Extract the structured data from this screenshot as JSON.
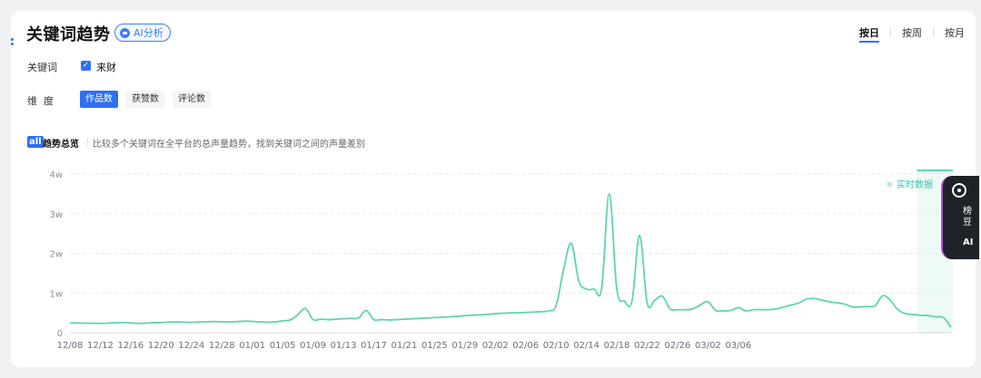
{
  "header": {
    "title": "关键词趋势",
    "ai_badge": "AI分析",
    "tabs": [
      {
        "label": "按日",
        "active": true
      },
      {
        "label": "按周",
        "active": false
      },
      {
        "label": "按月",
        "active": false
      }
    ]
  },
  "filters": {
    "keyword_label": "关键词",
    "keyword": "来财",
    "dimension_label": "维  度",
    "dimensions": [
      {
        "label": "作品数",
        "active": true
      },
      {
        "label": "获赞数",
        "active": false
      },
      {
        "label": "评论数",
        "active": false
      }
    ]
  },
  "section": {
    "icon_text": "all",
    "title": "趋势总览",
    "description": "比较多个关键词在全平台的总声量趋势，找到关键词之间的声量差别"
  },
  "realtime_label": "实时数据",
  "float_panel": {
    "text": "榜豆",
    "ai": "AI"
  },
  "colors": {
    "accent": "#2f6ff2",
    "line": "#5fd3b3",
    "realtime": "#36c5a4"
  },
  "chart_data": {
    "type": "line",
    "x_ticks": [
      "12/08",
      "12/12",
      "12/16",
      "12/20",
      "12/24",
      "12/28",
      "01/01",
      "01/05",
      "01/09",
      "01/13",
      "01/17",
      "01/21",
      "01/25",
      "01/29",
      "02/02",
      "02/06",
      "02/10",
      "02/14",
      "02/18",
      "02/22",
      "02/26",
      "03/02",
      "03/06"
    ],
    "y_ticks": [
      "0",
      "1w",
      "2w",
      "3w",
      "4w"
    ],
    "ylim": [
      0,
      40000
    ],
    "x_start": "2024-12-08",
    "series": [
      {
        "values": [
          2450,
          2440,
          2400,
          2380,
          2350,
          2400,
          2500,
          2550,
          2450,
          2350,
          2400,
          2500,
          2550,
          2650,
          2700,
          2650,
          2600,
          2700,
          2750,
          2800,
          2750,
          2700,
          2800,
          2900,
          2850,
          2700,
          2650,
          2700,
          3000,
          3200,
          4500,
          6100,
          3300,
          3400,
          3300,
          3400,
          3500,
          3600,
          3700,
          5600,
          3300,
          3300,
          3200,
          3300,
          3400,
          3500,
          3600,
          3700,
          3800,
          3900,
          4000,
          4100,
          4300,
          4400,
          4500,
          4600,
          4800,
          4900,
          5000,
          5000,
          5100,
          5200,
          5300,
          5500,
          6800,
          16000,
          22500,
          13000,
          11000,
          11000,
          11200,
          35000,
          11000,
          8000,
          8000,
          24500,
          7500,
          8200,
          9200,
          6000,
          5800,
          5800,
          6000,
          7000,
          7800,
          5600,
          5500,
          5600,
          6300,
          5500,
          5800,
          5800,
          5800,
          6000,
          6500,
          7000,
          7500,
          8500,
          8600,
          8200,
          7800,
          7500,
          7200,
          6500,
          6500,
          6600,
          6800,
          9300,
          8200,
          5800,
          4800,
          4600,
          4400,
          4300,
          4000,
          3800,
          1400
        ]
      }
    ],
    "realtime_from_index": 112
  }
}
